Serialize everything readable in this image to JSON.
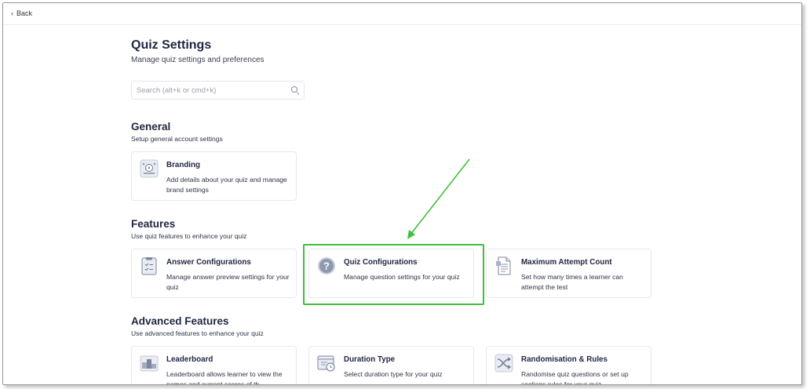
{
  "nav": {
    "back_label": "Back"
  },
  "header": {
    "title": "Quiz Settings",
    "subtitle": "Manage quiz settings and preferences"
  },
  "search": {
    "placeholder": "Search (alt+k or cmd+k)",
    "value": ""
  },
  "sections": {
    "general": {
      "title": "General",
      "subtitle": "Setup general account settings",
      "cards": [
        {
          "title": "Branding",
          "description": "Add details about your quiz and manage brand settings",
          "icon": "branding-icon"
        }
      ]
    },
    "features": {
      "title": "Features",
      "subtitle": "Use quiz features to enhance your quiz",
      "cards": [
        {
          "title": "Answer Configurations",
          "description": "Manage answer preview settings for your quiz",
          "icon": "clipboard-checklist-icon"
        },
        {
          "title": "Quiz Configurations",
          "description": "Manage question settings for your quiz",
          "icon": "question-circle-icon"
        },
        {
          "title": "Maximum Attempt Count",
          "description": "Set how many times a learner can attempt the test",
          "icon": "document-icon"
        }
      ]
    },
    "advanced": {
      "title": "Advanced Features",
      "subtitle": "Use advanced features to enhance your quiz",
      "cards": [
        {
          "title": "Leaderboard",
          "description": "Leaderboard allows learner to view the names and current scores of th...",
          "icon": "podium-icon"
        },
        {
          "title": "Duration Type",
          "description": "Select duration type for your quiz",
          "icon": "timer-window-icon"
        },
        {
          "title": "Randomisation & Rules",
          "description": "Randomise quiz questions or set up sections rules for your quiz",
          "icon": "shuffle-icon"
        }
      ]
    }
  },
  "colors": {
    "highlight": "#3fbf3f",
    "accent": "#1f2540"
  }
}
